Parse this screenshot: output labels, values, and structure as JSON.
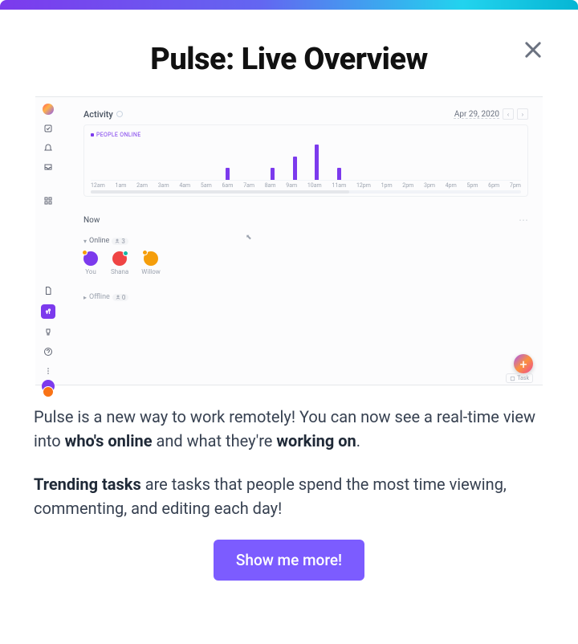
{
  "modal": {
    "title": "Pulse: Live Overview"
  },
  "demo": {
    "activity_label": "Activity",
    "date": "Apr 29, 2020",
    "legend": "PEOPLE ONLINE",
    "now_label": "Now",
    "online_label": "Online",
    "online_count": "3",
    "offline_label": "Offline",
    "offline_count": "0",
    "task_chip": "Task",
    "avatars": {
      "you": "You",
      "shana": "Shana",
      "willow": "Willow"
    }
  },
  "chart_data": {
    "type": "bar",
    "title": "Activity",
    "legend": [
      "PEOPLE ONLINE"
    ],
    "categories": [
      "12am",
      "1am",
      "2am",
      "3am",
      "4am",
      "5am",
      "6am",
      "7am",
      "8am",
      "9am",
      "10am",
      "11am",
      "12pm",
      "1pm",
      "2pm",
      "3pm",
      "4pm",
      "5pm",
      "6pm",
      "7pm"
    ],
    "values": [
      0,
      0,
      0,
      0,
      0,
      0,
      1,
      0,
      1,
      2,
      3,
      1,
      0,
      0,
      0,
      0,
      0,
      0,
      0,
      0
    ],
    "ylim": [
      0,
      3
    ],
    "xlabel": "",
    "ylabel": ""
  },
  "description": {
    "p1_a": "Pulse is a new way to work remotely! You can now see a real-time view into ",
    "p1_b1": "who's online",
    "p1_c": " and what they're ",
    "p1_b2": "working on",
    "p1_d": ".",
    "p2_b": "Trending tasks",
    "p2_t": " are tasks that people spend the most time viewing, commenting, and editing each day!"
  },
  "cta": {
    "label": "Show me more!"
  }
}
